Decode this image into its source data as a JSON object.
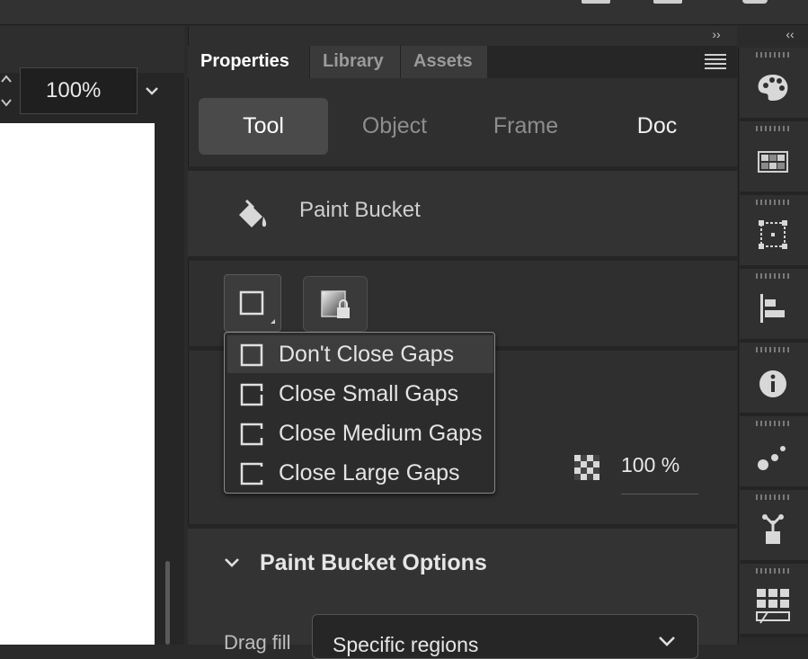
{
  "stage": {
    "zoom_value": "100%",
    "stepper_label": "⌃⌄"
  },
  "panel": {
    "collapse_label": "››",
    "tabs": [
      "Properties",
      "Library",
      "Assets"
    ],
    "segments": [
      "Tool",
      "Object",
      "Frame",
      "Doc"
    ],
    "active_segment": "Tool",
    "tool_name": "Paint Bucket",
    "opacity": "100 %",
    "options_title": "Paint Bucket Options",
    "drag_fill_label": "Drag fill",
    "drag_fill_value": "Specific regions"
  },
  "gap_menu": {
    "items": [
      "Don't Close Gaps",
      "Close Small Gaps",
      "Close Medium Gaps",
      "Close Large Gaps"
    ],
    "selected": "Don't Close Gaps"
  },
  "dock": {
    "collapse_label": "‹‹",
    "icons": [
      "palette-icon",
      "swatches-icon",
      "transform-icon",
      "align-icon",
      "info-icon",
      "motion-presets-icon",
      "components-icon",
      "frame-picker-icon"
    ]
  },
  "colors": {
    "panel_bg": "#2f2f2f",
    "active_tab": "#4a4a4a",
    "stage_white": "#ffffff",
    "menu_border": "#8a8a8a"
  }
}
